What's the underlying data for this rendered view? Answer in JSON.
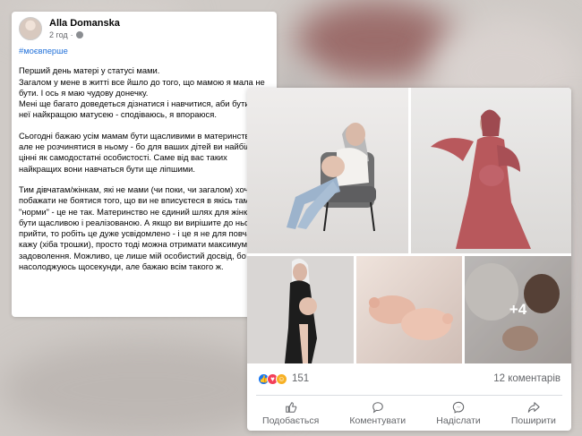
{
  "post": {
    "author": "Alla Domanska",
    "time": "2 год",
    "hashtag": "#моєвперше",
    "paragraphs": [
      "Перший день матері у статусі мами.\nЗагалом у мене в житті все йшло до того, що мамою я мала не бути. І ось я маю чудову донечку.\nМені ще багато доведеться дізнатися і навчитися, аби бути для неї найкращою матусею - сподіваюсь, я впораюся.",
      "Сьогодні бажаю усім мамам бути щасливими в материнстві, але не розчинятися в ньому - бо для ваших дітей ви найбільш цінні як самодостатні особистості. Саме від вас таких найкращих вони навчаться бути ще ліпшими.",
      "Тим дівчатам/жінкам, які не мами (чи поки, чи загалом) хочу побажати не боятися того, що ви не вписуєтеся в якісь там \"норми\" - це не так. Материнство не єдиний шлях для жінки бути щасливою і реалізованою. А якщо ви вирішите до нього прийти, то робіть це дуже усвідомлено - і це я не для повчань кажу (хіба трошки), просто тоді можна отримати максимум задоволення. Можливо, це лише мій особистий досвід, бо я насолоджуюсь щосекунди, але бажаю всім такого ж."
    ]
  },
  "card": {
    "more_photos": "+4",
    "reaction_count": "151",
    "comments": "12 коментарів",
    "actions": {
      "like": "Подобається",
      "comment": "Коментувати",
      "send": "Надіслати",
      "share": "Поширити"
    }
  },
  "colors": {
    "hashtag": "#1f6fd9",
    "dress": "#b8585c",
    "reaction_like": "#1877f2",
    "reaction_love": "#f33e58",
    "reaction_care": "#f7b125"
  },
  "icons": [
    "globe-icon",
    "like-icon",
    "comment-icon",
    "messenger-icon",
    "share-icon"
  ]
}
